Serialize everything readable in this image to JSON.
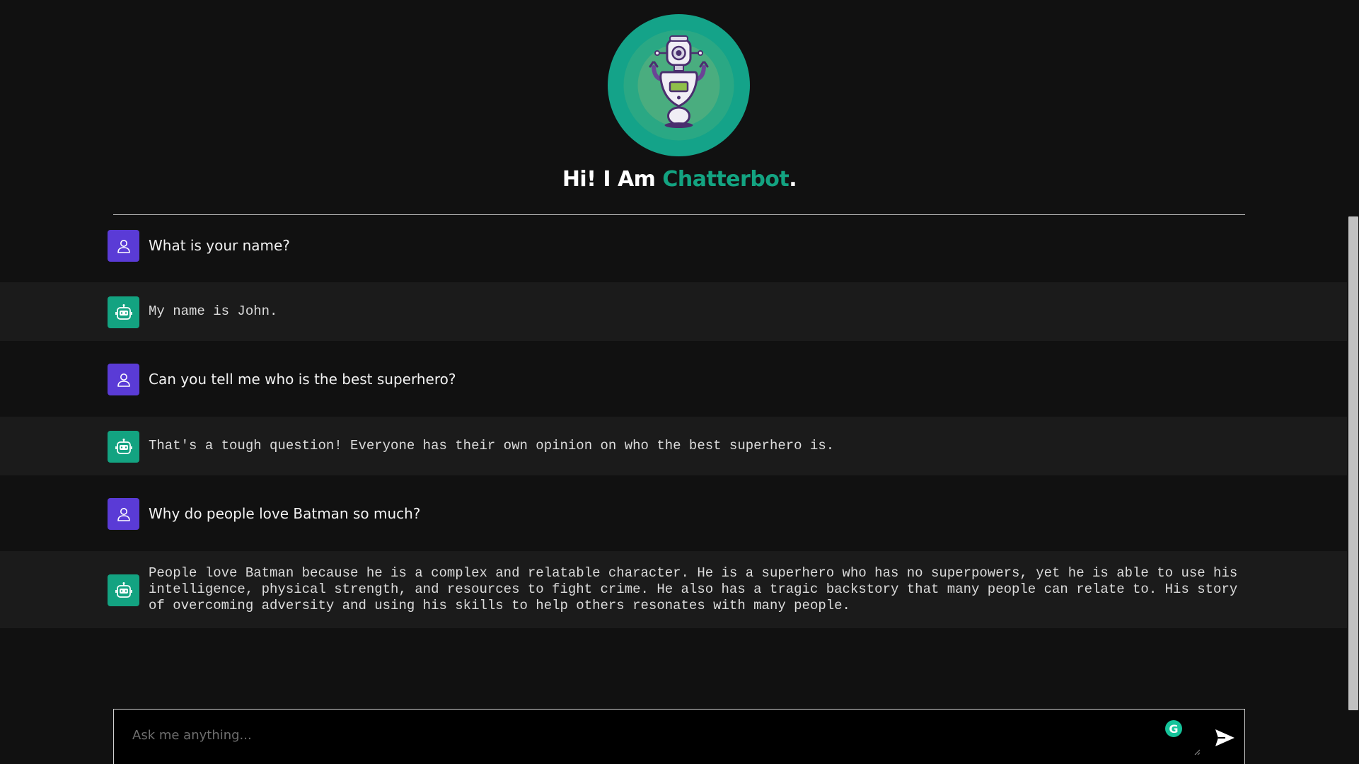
{
  "header": {
    "greeting": "Hi! I Am ",
    "brand": "Chatterbot",
    "punct": "."
  },
  "messages": [
    {
      "role": "user",
      "text": "What is your name?"
    },
    {
      "role": "bot",
      "text": "My name is John."
    },
    {
      "role": "user",
      "text": "Can you tell me who is the best superhero?"
    },
    {
      "role": "bot",
      "text": "That's a tough question! Everyone has their own opinion on who the best superhero is."
    },
    {
      "role": "user",
      "text": "Why do people love Batman so much?"
    },
    {
      "role": "bot",
      "text": "People love Batman because he is a complex and relatable character. He is a superhero who has no superpowers, yet he is able to use his intelligence, physical strength, and resources to fight crime. He also has a tragic backstory that many people can relate to. His story of overcoming adversity and using his skills to help others resonates with many people."
    }
  ],
  "input": {
    "placeholder": "Ask me anything...",
    "grammarly_glyph": "G"
  },
  "icons": {
    "user": "user-icon",
    "bot": "robot-icon",
    "send": "send-icon",
    "grammarly": "grammarly-icon"
  },
  "colors": {
    "background": "#111111",
    "bot_row": "#1b1b1b",
    "brand": "#13a381",
    "user_avatar": "#5a3bd6",
    "bot_avatar": "#13a381"
  }
}
